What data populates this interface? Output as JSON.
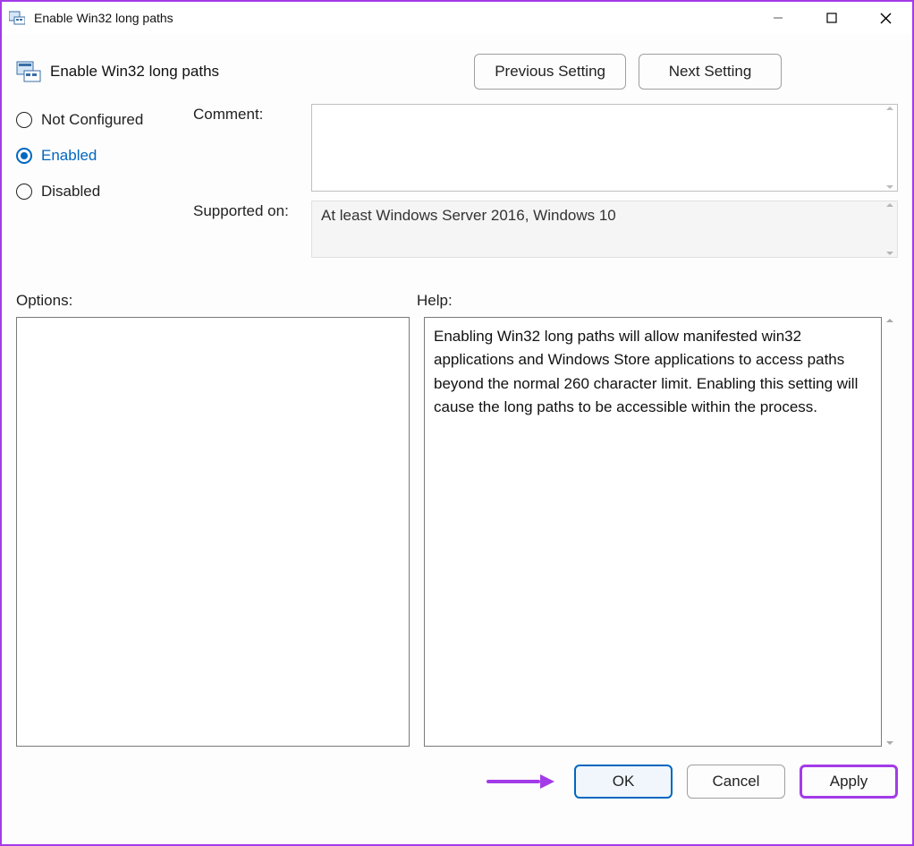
{
  "window": {
    "title": "Enable Win32 long paths",
    "controls": {
      "minimize": "minimize-icon",
      "maximize": "maximize-icon",
      "close": "close-icon"
    }
  },
  "header": {
    "title": "Enable Win32 long paths",
    "prev_label": "Previous Setting",
    "next_label": "Next Setting"
  },
  "radios": {
    "not_configured": "Not Configured",
    "enabled": "Enabled",
    "disabled": "Disabled",
    "selected": "enabled"
  },
  "fields": {
    "comment_label": "Comment:",
    "comment_value": "",
    "supported_label": "Supported on:",
    "supported_value": "At least Windows Server 2016, Windows 10"
  },
  "sections": {
    "options_label": "Options:",
    "help_label": "Help:"
  },
  "help_text": "Enabling Win32 long paths will allow manifested win32 applications and Windows Store applications to access paths beyond the normal 260 character limit.  Enabling this setting will cause the long paths to be accessible within the process.",
  "footer": {
    "ok": "OK",
    "cancel": "Cancel",
    "apply": "Apply"
  },
  "colors": {
    "accent": "#0067c0",
    "highlight": "#a33be8"
  }
}
